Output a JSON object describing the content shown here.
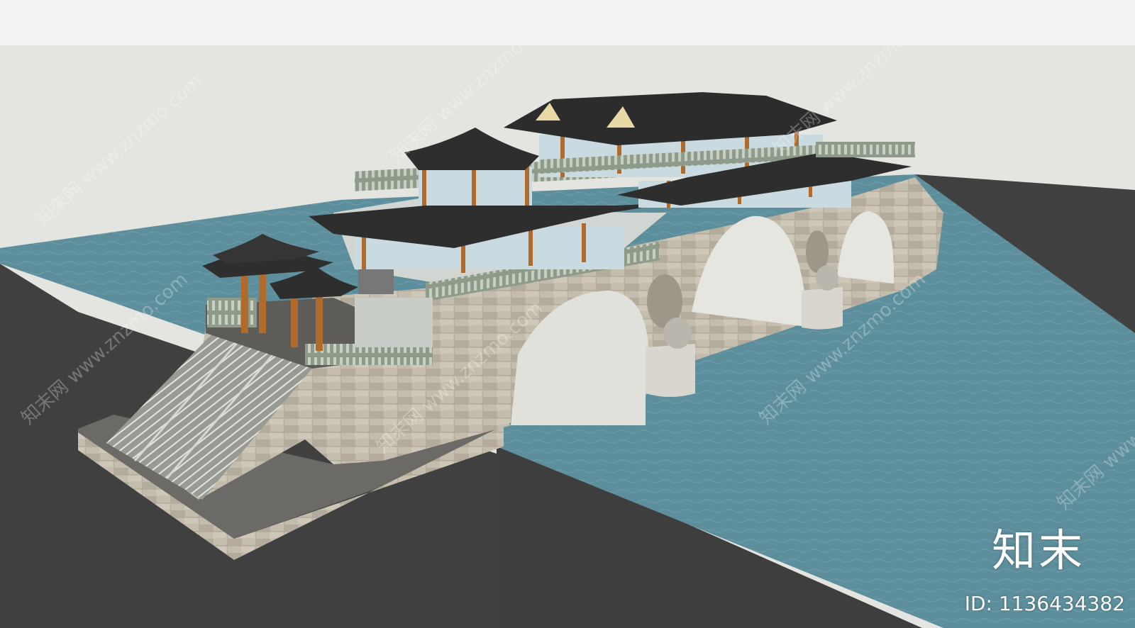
{
  "watermark": {
    "logo_text": "知末",
    "id_text": "ID: 1136434382",
    "repeated_text": "知末网 www.znzmo.com"
  },
  "colors": {
    "sky": "#e4e4e1",
    "top_band": "#f1f2f1",
    "ground": "#404040",
    "water": "#5a8a99",
    "stone": "#bdb6a8",
    "roof": "#2e2e2e",
    "timber": "#b06a2b",
    "glass": "#c9dbe0"
  }
}
